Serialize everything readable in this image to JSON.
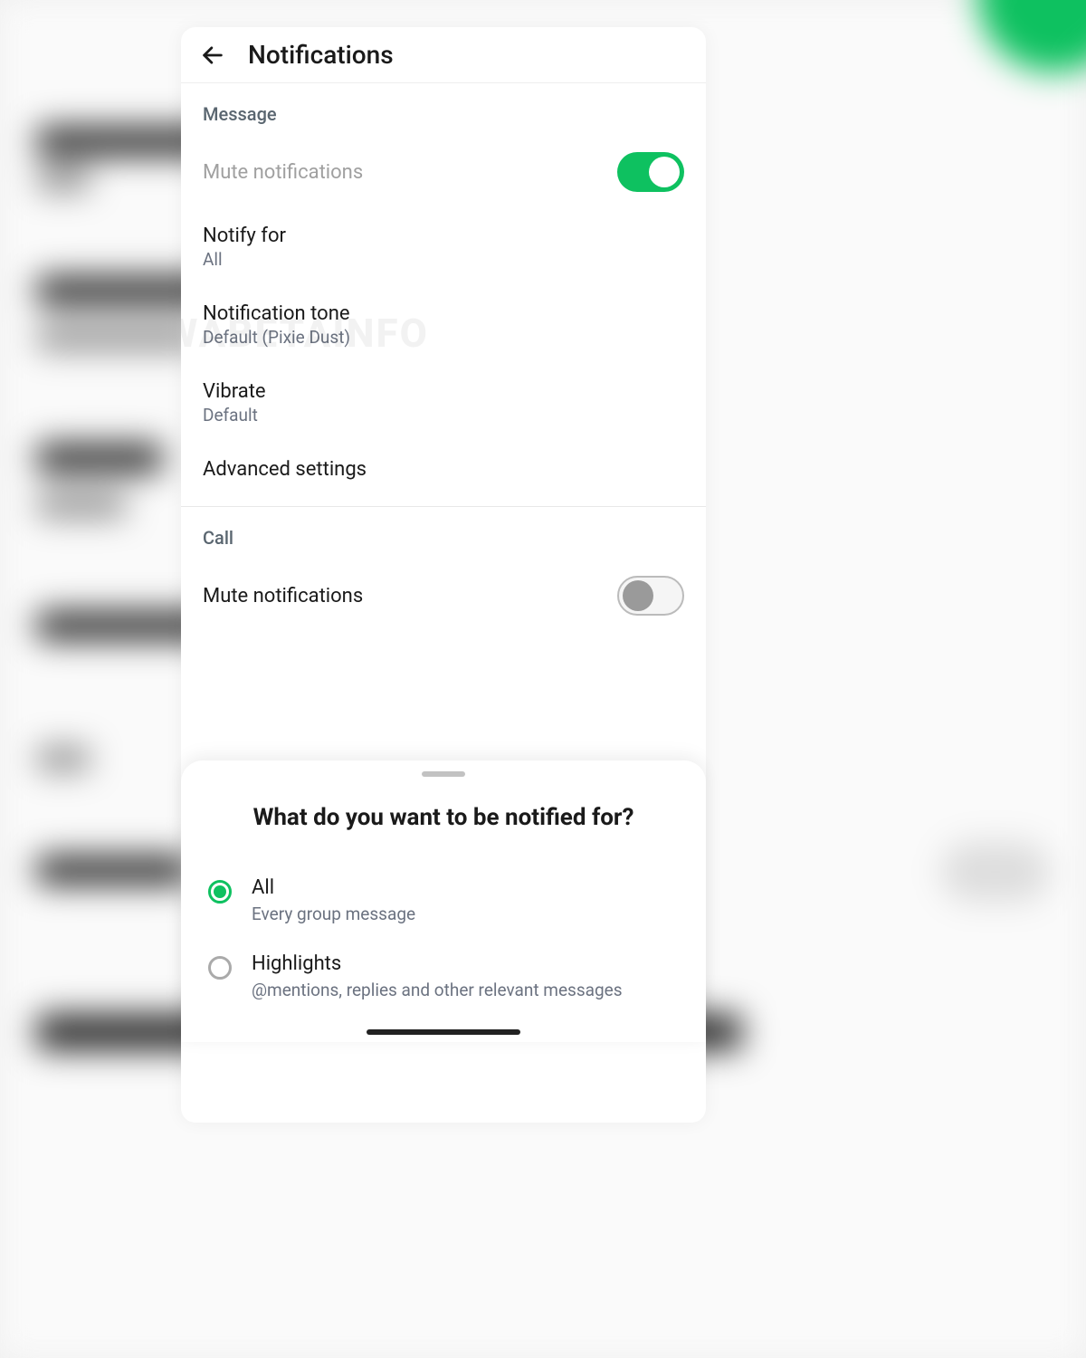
{
  "header": {
    "title": "Notifications"
  },
  "sections": {
    "message": {
      "header": "Message",
      "mute": {
        "label": "Mute notifications",
        "on": true
      },
      "notify_for": {
        "label": "Notify for",
        "value": "All"
      },
      "tone": {
        "label": "Notification tone",
        "value": "Default (Pixie Dust)"
      },
      "vibrate": {
        "label": "Vibrate",
        "value": "Default"
      },
      "advanced": {
        "label": "Advanced settings"
      }
    },
    "call": {
      "header": "Call",
      "mute": {
        "label": "Mute notifications",
        "on": false
      }
    }
  },
  "sheet": {
    "title": "What do you want to be notified for?",
    "options": [
      {
        "label": "All",
        "desc": "Every group message",
        "selected": true
      },
      {
        "label": "Highlights",
        "desc": "@mentions, replies and other relevant messages",
        "selected": false
      }
    ]
  },
  "watermark": "WABETAINFO"
}
